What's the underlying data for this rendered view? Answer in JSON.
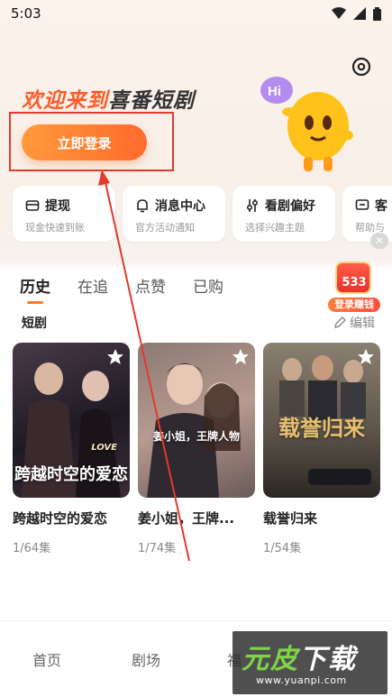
{
  "status_bar": {
    "time": "5:03"
  },
  "header": {
    "welcome_red": "欢迎来到",
    "welcome_dark": "喜番短剧",
    "login_button": "立即登录"
  },
  "quick_actions": [
    {
      "title": "提现",
      "subtitle": "现金快速到账",
      "icon": "wallet-icon"
    },
    {
      "title": "消息中心",
      "subtitle": "官方活动通知",
      "icon": "bell-icon"
    },
    {
      "title": "看剧偏好",
      "subtitle": "选择兴趣主题",
      "icon": "sliders-icon"
    },
    {
      "title": "客",
      "subtitle": "帮助与",
      "icon": "chat-icon"
    }
  ],
  "tabs": [
    {
      "label": "历史",
      "active": true
    },
    {
      "label": "在追",
      "active": false
    },
    {
      "label": "点赞",
      "active": false
    },
    {
      "label": "已购",
      "active": false
    }
  ],
  "promo": {
    "count": "533",
    "label": "登录赚钱"
  },
  "section": {
    "title": "短剧",
    "edit_label": "编辑"
  },
  "dramas": [
    {
      "title": "跨越时空的爱恋",
      "episodes": "1/64集",
      "poster_text": "跨越时空的爱恋",
      "poster_tag": "LOVE",
      "colors": [
        "#2a1f2c",
        "#5a3a4a"
      ]
    },
    {
      "title": "姜小姐，王牌...",
      "episodes": "1/74集",
      "poster_text": "姜小姐，王牌人物",
      "poster_tag": "",
      "colors": [
        "#6a5a5a",
        "#c8a8a0"
      ]
    },
    {
      "title": "载誉归来",
      "episodes": "1/54集",
      "poster_text": "载誉归来",
      "poster_tag": "",
      "colors": [
        "#3a3630",
        "#9a8a70"
      ]
    }
  ],
  "bottom_nav": [
    {
      "label": "首页"
    },
    {
      "label": "剧场"
    },
    {
      "label": "福"
    }
  ],
  "watermark": {
    "logo_green": "元皮",
    "logo_white": "下载",
    "url": "www.yuanpi.com"
  }
}
